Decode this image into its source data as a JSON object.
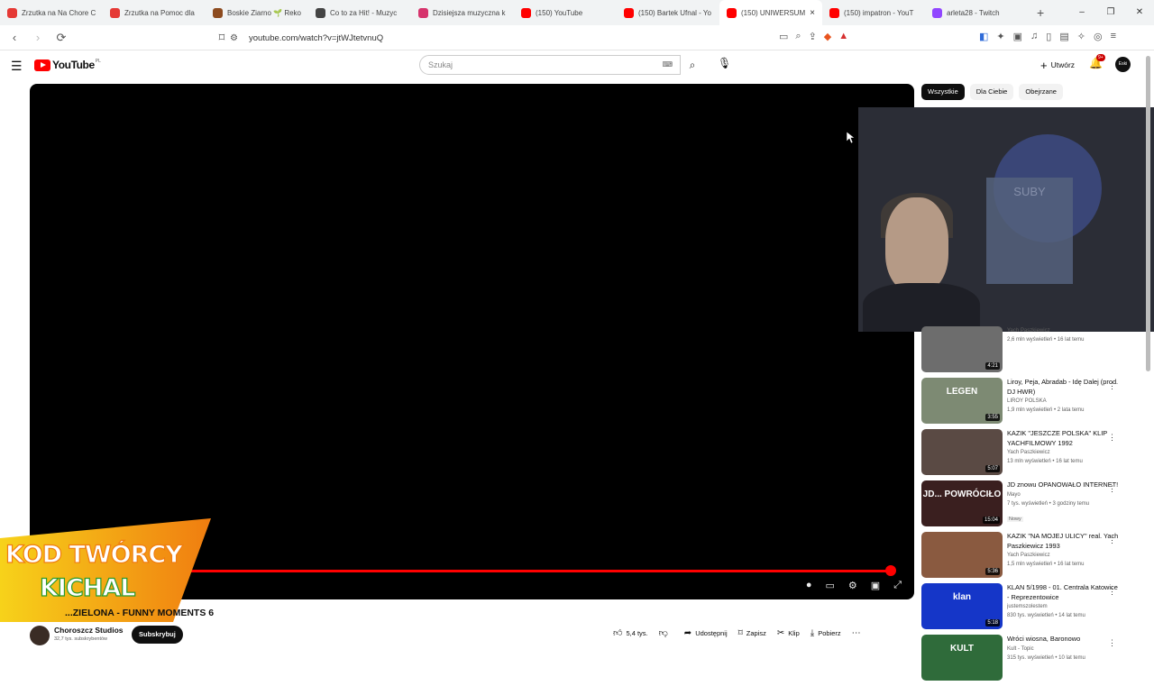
{
  "browser": {
    "tabs": [
      {
        "label": "Zrzutka na Na Chore C",
        "color": "#e53935"
      },
      {
        "label": "Zrzutka na Pomoc dla",
        "color": "#e53935"
      },
      {
        "label": "Boskie Ziarno 🌱 Reko",
        "color": "#8d4b1f"
      },
      {
        "label": "Co to za Hit! - Muzyc",
        "color": "#444444"
      },
      {
        "label": "Dzisiejsza muzyczna k",
        "color": "#d6336c"
      },
      {
        "label": "(150) YouTube",
        "color": "#ff0000"
      },
      {
        "label": "(150) Bartek Ufnal - Yo",
        "color": "#ff0000"
      },
      {
        "label": "(150) UNIWERSUM",
        "color": "#ff0000",
        "active": true
      },
      {
        "label": "(150) impatron - YouT",
        "color": "#ff0000"
      },
      {
        "label": "arleta28 - Twitch",
        "color": "#9146ff"
      }
    ],
    "close_tab_icon": "×",
    "new_tab_icon": "+",
    "url": "youtube.com/watch?v=jtWJtetvnuQ",
    "window_controls": [
      "–",
      "❐",
      "✕"
    ]
  },
  "youtube": {
    "logo_text": "YouTube",
    "logo_country": "PL",
    "search_placeholder": "Szukaj",
    "create_label": "Utwórz",
    "notifications_badge": "9+",
    "avatar_text": "Eski"
  },
  "player": {
    "progress_fraction": 0.973,
    "promo_line1": "KOD TWÓRCY",
    "promo_line2": "KICHAL"
  },
  "webcam": {
    "poster_text": "SUBY"
  },
  "chips": [
    "Wszystkie",
    "Dla Ciebie",
    "Obejrzane"
  ],
  "recommendations": [
    {
      "title": "",
      "channel": "Yach Paszkiewicz",
      "stats": "2,6 mln wyświetleń • 16 lat temu",
      "duration": "4:21",
      "thumb_color": "#6d6d6d",
      "thumb_text": ""
    },
    {
      "title": "Liroy, Peja, Abradab - Idę Dalej (prod. DJ HWR)",
      "channel": "LIROY POLSKA",
      "stats": "1,9 mln wyświetleń • 2 lata temu",
      "duration": "3:55",
      "thumb_color": "#7d8a73",
      "thumb_text": "LEGEN"
    },
    {
      "title": "KAZIK \"JESZCZE POLSKA\" KLIP YACHFILMOWY 1992",
      "channel": "Yach Paszkiewicz",
      "stats": "13 mln wyświetleń • 16 lat temu",
      "duration": "5:07",
      "thumb_color": "#5a4a44",
      "thumb_text": ""
    },
    {
      "title": "JD znowu OPANOWAŁO INTERNET!",
      "channel": "Mayo",
      "stats": "7 tys. wyświetleń • 3 godziny temu",
      "duration": "15:04",
      "thumb_color": "#3a1f1f",
      "thumb_text": "JD... POWRÓCIŁO",
      "badge": "Nowy"
    },
    {
      "title": "KAZIK \"NA MOJEJ ULICY\" real. Yach Paszkiewicz 1993",
      "channel": "Yach Paszkiewicz",
      "stats": "1,5 mln wyświetleń • 16 lat temu",
      "duration": "5:36",
      "thumb_color": "#8a5a40",
      "thumb_text": ""
    },
    {
      "title": "KLAN 5/1998 - 01. Centrala Katowice - Reprezentowice",
      "channel": "justemszolestem",
      "stats": "830 tys. wyświetleń • 14 lat temu",
      "duration": "5:18",
      "thumb_color": "#1536c8",
      "thumb_text": "klan"
    },
    {
      "title": "Wróci wiosna, Baronowo",
      "channel": "Kult - Topic",
      "stats": "315 tys. wyświetleń • 10 lat temu",
      "duration": "",
      "thumb_color": "#2f6b3a",
      "thumb_text": "KULT"
    }
  ],
  "video": {
    "title": "...ZIELONA - FUNNY MOMENTS 6",
    "channel": "Choroszcz Studios",
    "subscribers": "32,7 tys. subskrybentów",
    "subscribe_label": "Subskrybuj",
    "likes": "5,4 tys.",
    "share_label": "Udostępnij",
    "save_label": "Zapisz",
    "clip_label": "Klip",
    "download_label": "Pobierz"
  }
}
